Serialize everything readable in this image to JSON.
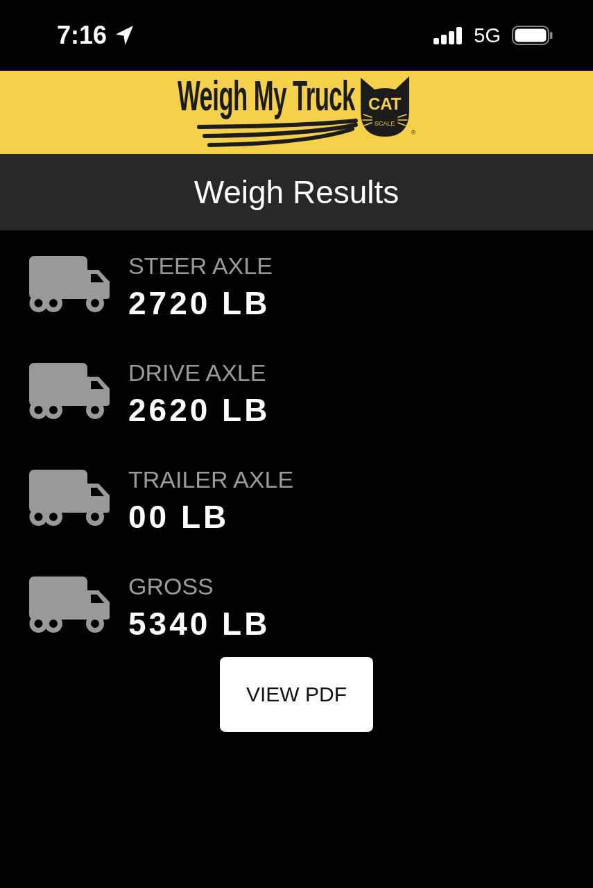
{
  "status_bar": {
    "time": "7:16",
    "network": "5G"
  },
  "header": {
    "logo": {
      "wordmark": "Weigh My Truck",
      "badge": "CAT",
      "badge_caption": "SCALE",
      "registered_mark": "®"
    }
  },
  "title_bar": {
    "title": "Weigh Results"
  },
  "results": [
    {
      "label": "STEER AXLE",
      "value": "2720 LB"
    },
    {
      "label": "DRIVE AXLE",
      "value": "2620 LB"
    },
    {
      "label": "TRAILER AXLE",
      "value": "00 LB"
    },
    {
      "label": "GROSS",
      "value": "5340 LB"
    }
  ],
  "buttons": [
    {
      "label": "VIEW PDF"
    }
  ]
}
